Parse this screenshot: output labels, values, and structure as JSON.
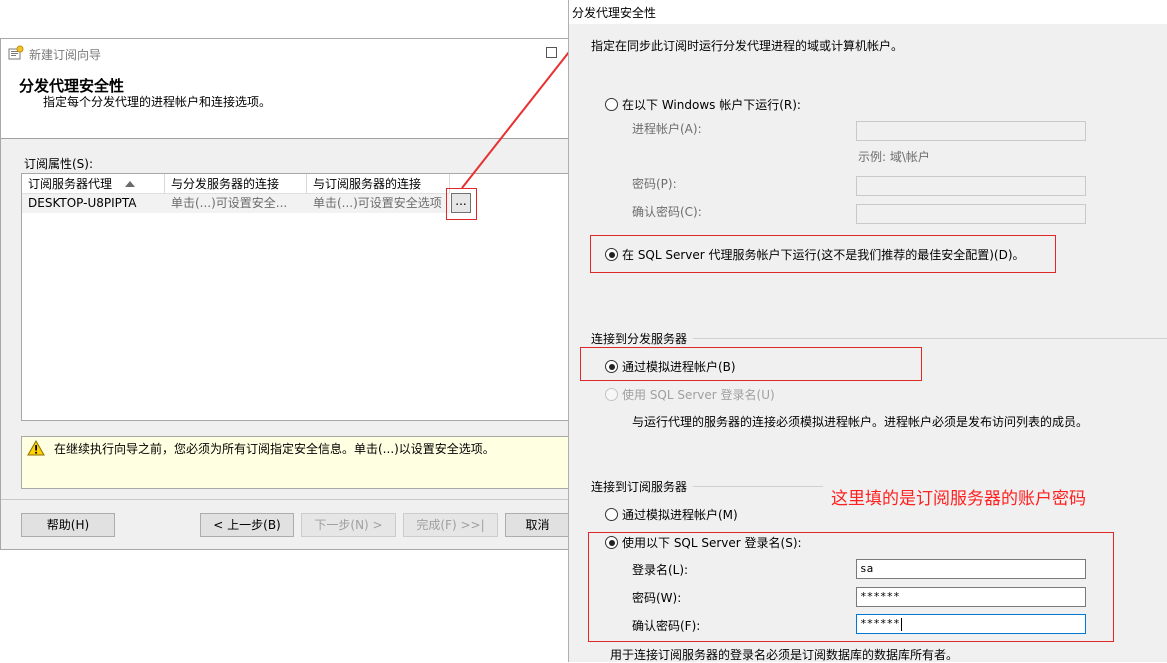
{
  "wizard": {
    "window_title": "新建订阅向导",
    "page_title": "分发代理安全性",
    "page_subtitle": "指定每个分发代理的进程帐户和连接选项。",
    "subscription_properties_label": "订阅属性(S):",
    "grid": {
      "columns": [
        "订阅服务器代理",
        "与分发服务器的连接",
        "与订阅服务器的连接"
      ],
      "sort_icon": "sort-ascending-icon",
      "rows": [
        [
          "DESKTOP-U8PIPTA",
          "单击(...)可设置安全...",
          "单击(...)可设置安全选项"
        ]
      ],
      "ellipsis_label": "..."
    },
    "warning_text": "在继续执行向导之前，您必须为所有订阅指定安全信息。单击(...)以设置安全选项。",
    "buttons": {
      "help": "帮助(H)",
      "back": "< 上一步(B)",
      "next": "下一步(N) >",
      "finish": "完成(F) >>|",
      "cancel": "取消"
    }
  },
  "dialog": {
    "title": "分发代理安全性",
    "description": "指定在同步此订阅时运行分发代理进程的域或计算机帐户。",
    "process_account": {
      "option_windows": "在以下 Windows 帐户下运行(R):",
      "process_account_label": "进程帐户(A):",
      "example_hint": "示例: 域\\帐户",
      "password_label": "密码(P):",
      "confirm_password_label": "确认密码(C):",
      "option_agent": "在 SQL Server 代理服务帐户下运行(这不是我们推荐的最佳安全配置)(D)。",
      "selected": "agent"
    },
    "distributor": {
      "group_label": "连接到分发服务器",
      "option_impersonate": "通过模拟进程帐户(B)",
      "option_sql_login": "使用 SQL Server 登录名(U)",
      "note": "与运行代理的服务器的连接必须模拟进程帐户。进程帐户必须是发布访问列表的成员。",
      "selected": "impersonate"
    },
    "subscriber": {
      "group_label": "连接到订阅服务器",
      "option_impersonate": "通过模拟进程帐户(M)",
      "option_sql_login": "使用以下 SQL Server 登录名(S):",
      "login_label": "登录名(L):",
      "login_value": "sa",
      "password_label": "密码(W):",
      "password_value": "******",
      "confirm_label": "确认密码(F):",
      "confirm_value": "******",
      "note": "用于连接订阅服务器的登录名必须是订阅数据库的数据库所有者。",
      "selected": "sql_login"
    },
    "annotation": "这里填的是订阅服务器的账户密码"
  },
  "colors": {
    "highlight_red": "#e02828",
    "annotation_red": "#ff2020",
    "warning_bg": "#ffffe1",
    "window_bg": "#f0f0f0"
  }
}
